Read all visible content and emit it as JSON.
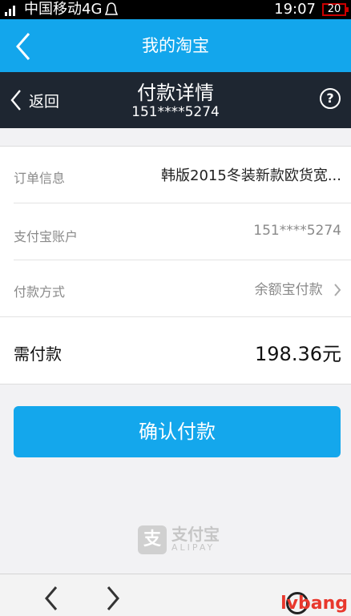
{
  "status_bar": {
    "carrier": "中国移动4G",
    "time": "19:07",
    "battery": "20"
  },
  "top_bar": {
    "title": "我的淘宝"
  },
  "payment_header": {
    "back_label": "返回",
    "title": "付款详情",
    "account": "151****5274",
    "help_label": "?"
  },
  "details": {
    "order_label": "订单信息",
    "order_value": "韩版2015冬装新款欧货宽...",
    "account_label": "支付宝账户",
    "account_value": "151****5274",
    "method_label": "付款方式",
    "method_value": "余额宝付款",
    "total_label": "需付款",
    "total_value": "198.36元"
  },
  "confirm_button": "确认付款",
  "logo": {
    "mark": "支",
    "name": "支付宝",
    "sub": "ALIPAY"
  },
  "watermark": "lvbang"
}
